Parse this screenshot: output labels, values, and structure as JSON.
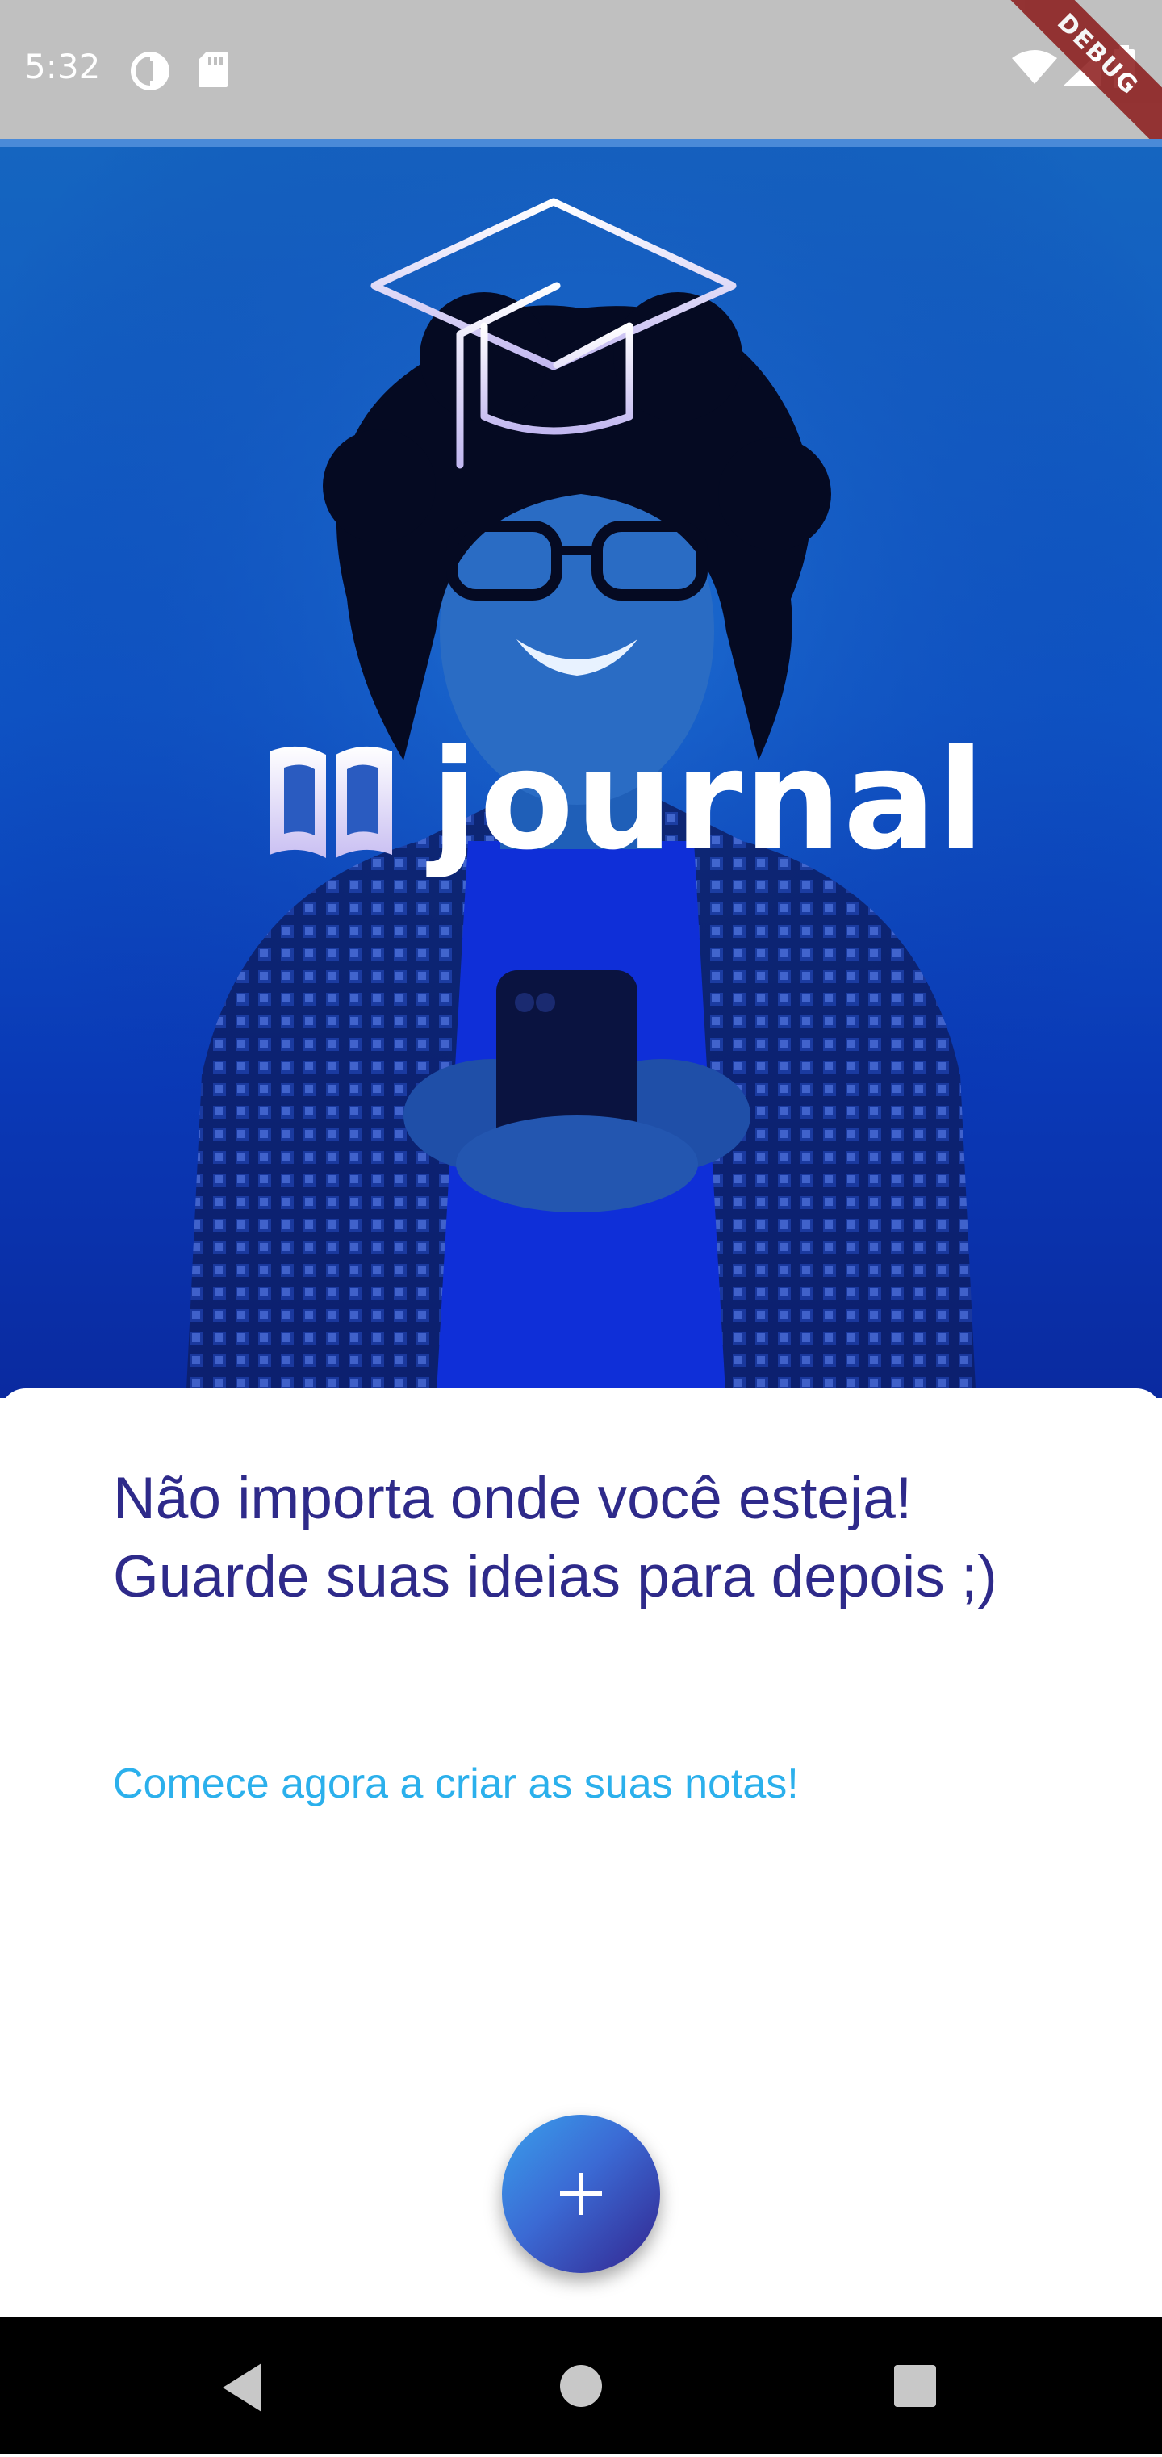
{
  "status_bar": {
    "time": "5:32",
    "debug_label": "DEBUG",
    "icons": [
      "data-saver-icon",
      "sd-card-icon",
      "wifi-icon",
      "signal-icon",
      "battery-icon"
    ]
  },
  "hero": {
    "brand_name": "journal",
    "icons": [
      "graduation-cap-icon",
      "open-book-icon"
    ],
    "colors": {
      "gradient_top": "#1565c0",
      "gradient_bottom": "#0a2aa0"
    }
  },
  "card": {
    "title": "Não importa onde você esteja! Guarde suas ideias para depois ;)",
    "subtitle": "Comece agora a criar as suas notas!",
    "colors": {
      "title": "#2e2a8a",
      "subtitle": "#2bb0ec"
    }
  },
  "fab": {
    "icon": "plus-icon"
  },
  "nav_bar": {
    "buttons": [
      "back-icon",
      "home-icon",
      "recents-icon"
    ]
  }
}
